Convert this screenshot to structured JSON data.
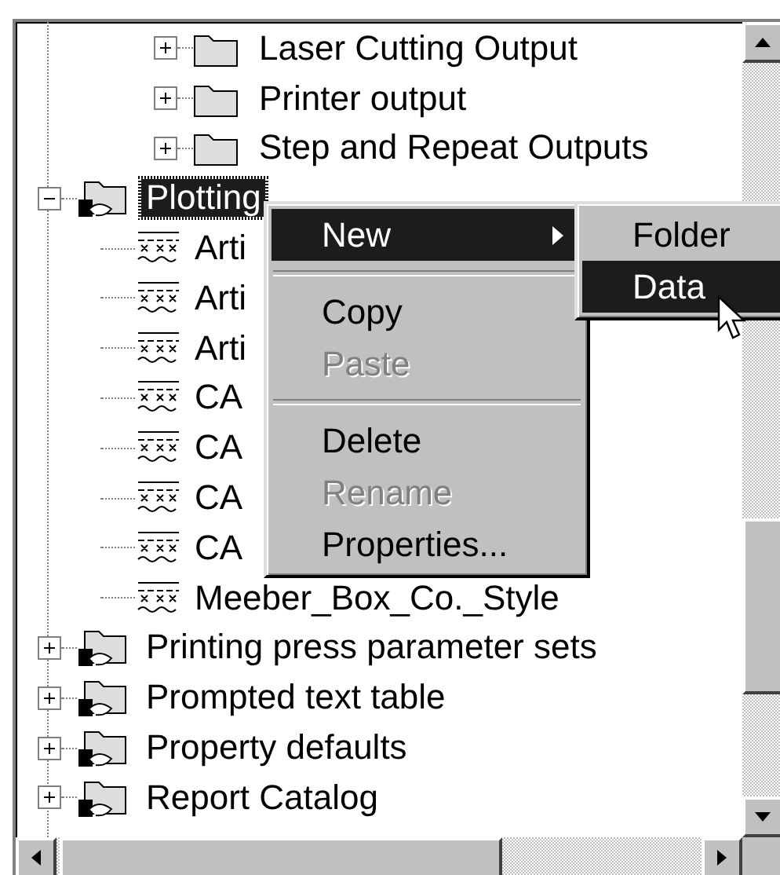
{
  "tree": {
    "continued_children": [
      {
        "label": "Laser Cutting Output",
        "kind": "folder",
        "expanded": false,
        "selected": false
      },
      {
        "label": "Printer output",
        "kind": "folder",
        "expanded": false,
        "selected": false
      },
      {
        "label": "Step and Repeat Outputs",
        "kind": "folder",
        "expanded": false,
        "selected": false
      }
    ],
    "items": [
      {
        "label": "Plotting",
        "kind": "catalog",
        "expanded": true,
        "selected": true,
        "children": [
          {
            "label": "Arti",
            "kind": "data",
            "selected": false
          },
          {
            "label": "Arti",
            "kind": "data",
            "selected": false
          },
          {
            "label": "Arti",
            "kind": "data",
            "selected": false
          },
          {
            "label": "CA",
            "kind": "data",
            "selected": false
          },
          {
            "label": "CA",
            "kind": "data",
            "selected": false
          },
          {
            "label": "CA",
            "kind": "data",
            "selected": false
          },
          {
            "label": "CA",
            "kind": "data",
            "selected": false
          },
          {
            "label": "Meeber_Box_Co._Style",
            "kind": "data",
            "selected": false
          }
        ]
      },
      {
        "label": "Printing press parameter sets",
        "kind": "catalog",
        "expanded": false,
        "selected": false
      },
      {
        "label": "Prompted text table",
        "kind": "catalog",
        "expanded": false,
        "selected": false
      },
      {
        "label": "Property defaults",
        "kind": "catalog",
        "expanded": false,
        "selected": false
      },
      {
        "label": "Report Catalog",
        "kind": "catalog",
        "expanded": false,
        "selected": false
      }
    ]
  },
  "context_menu": {
    "items": [
      {
        "kind": "item",
        "label": "New",
        "submenu": true,
        "selected": true,
        "disabled": false
      },
      {
        "kind": "separator"
      },
      {
        "kind": "item",
        "label": "Copy",
        "submenu": false,
        "selected": false,
        "disabled": false
      },
      {
        "kind": "item",
        "label": "Paste",
        "submenu": false,
        "selected": false,
        "disabled": true
      },
      {
        "kind": "separator"
      },
      {
        "kind": "item",
        "label": "Delete",
        "submenu": false,
        "selected": false,
        "disabled": false
      },
      {
        "kind": "item",
        "label": "Rename",
        "submenu": false,
        "selected": false,
        "disabled": true
      },
      {
        "kind": "item",
        "label": "Properties...",
        "submenu": false,
        "selected": false,
        "disabled": false
      }
    ]
  },
  "submenu": {
    "items": [
      {
        "label": "Folder",
        "selected": false
      },
      {
        "label": "Data",
        "selected": true
      }
    ]
  }
}
